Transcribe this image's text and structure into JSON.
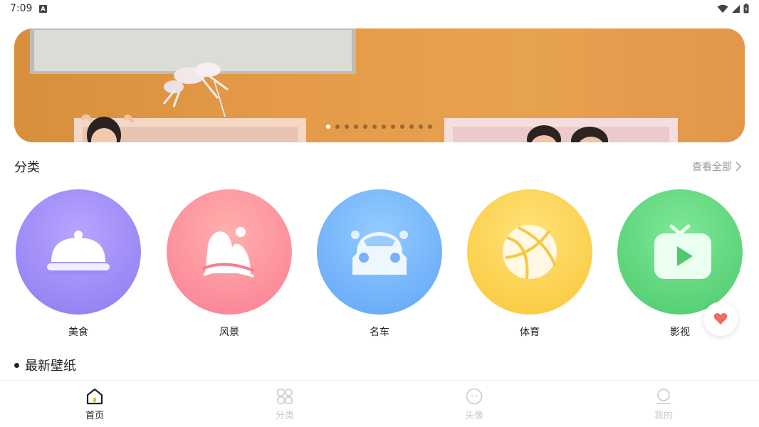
{
  "status_bar": {
    "time": "7:09"
  },
  "banner": {
    "total_slides": 12,
    "active_slide": 1
  },
  "categories": {
    "title": "分类",
    "view_all": "查看全部",
    "items": [
      {
        "label": "美食",
        "icon": "food-cloche-icon",
        "color_top": "#b9a3ff",
        "color_bottom": "#8c7cf0"
      },
      {
        "label": "风景",
        "icon": "landscape-icon",
        "color_top": "#ffa2a6",
        "color_bottom": "#fb7f96"
      },
      {
        "label": "名车",
        "icon": "car-icon",
        "color_top": "#8ec8ff",
        "color_bottom": "#63a6f8"
      },
      {
        "label": "体育",
        "icon": "basketball-icon",
        "color_top": "#ffe071",
        "color_bottom": "#f9c93a"
      },
      {
        "label": "影视",
        "icon": "tv-play-icon",
        "color_top": "#7ae592",
        "color_bottom": "#4fce6f"
      }
    ]
  },
  "latest": {
    "title": "最新壁纸"
  },
  "bottom_nav": [
    {
      "label": "首页",
      "icon": "home-icon",
      "active": true
    },
    {
      "label": "分类",
      "icon": "grid-icon",
      "active": false
    },
    {
      "label": "头像",
      "icon": "avatar-icon",
      "active": false
    },
    {
      "label": "我的",
      "icon": "profile-icon",
      "active": false
    }
  ],
  "colors": {
    "heart": "#f06a5e",
    "active_nav": "#222222",
    "inactive_nav": "#c9c9c9"
  }
}
